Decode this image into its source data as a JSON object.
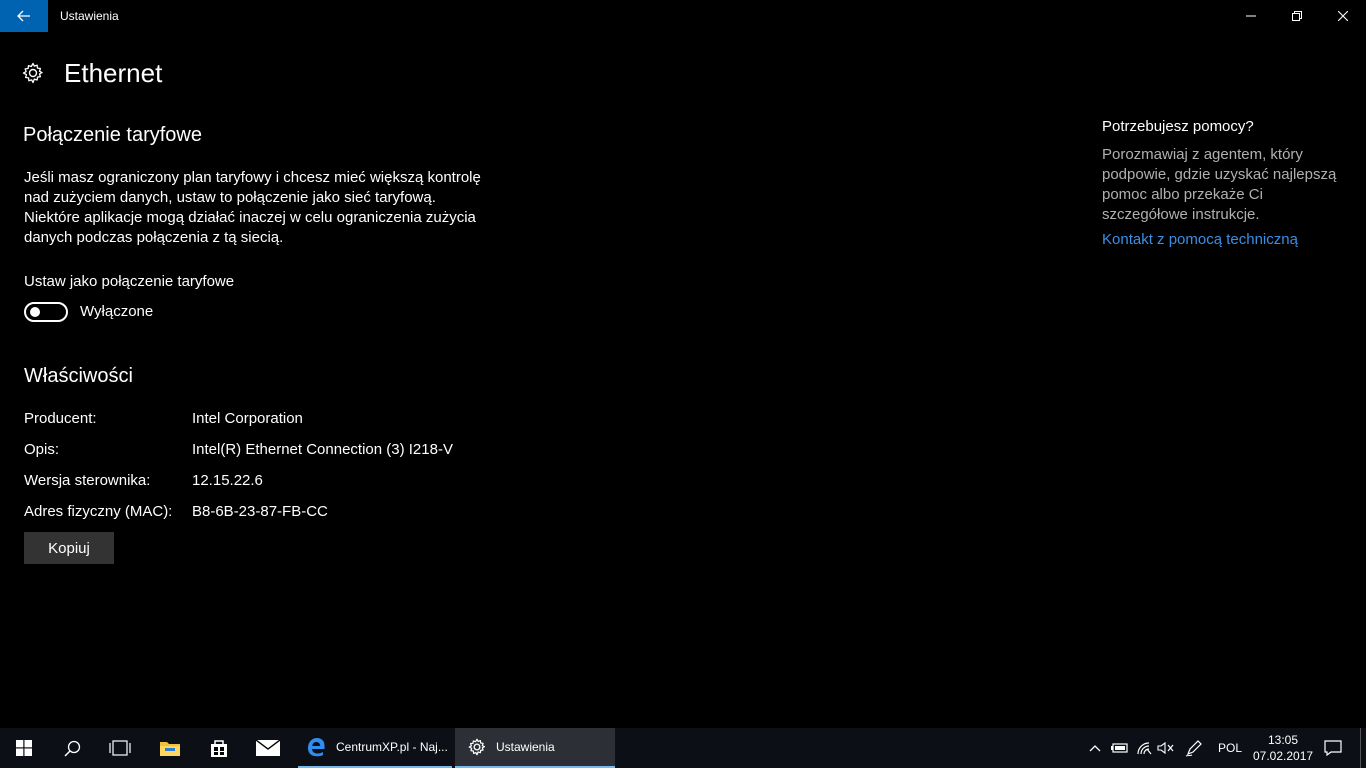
{
  "window": {
    "app_title": "Ustawienia"
  },
  "page": {
    "title": "Ethernet"
  },
  "metered": {
    "heading": "Połączenie taryfowe",
    "description": "Jeśli masz ograniczony plan taryfowy i chcesz mieć większą kontrolę nad zużyciem danych, ustaw to połączenie jako sieć taryfową. Niektóre aplikacje mogą działać inaczej w celu ograniczenia zużycia danych podczas połączenia z tą siecią.",
    "toggle_label": "Ustaw jako połączenie taryfowe",
    "toggle_state": "Wyłączone",
    "toggle_on": false
  },
  "properties": {
    "heading": "Właściwości",
    "rows": [
      {
        "key": "Producent:",
        "value": "Intel Corporation"
      },
      {
        "key": "Opis:",
        "value": "Intel(R) Ethernet Connection (3) I218-V"
      },
      {
        "key": "Wersja sterownika:",
        "value": "12.15.22.6"
      },
      {
        "key": "Adres fizyczny (MAC):",
        "value": "B8-6B-23-87-FB-CC"
      }
    ],
    "copy_label": "Kopiuj"
  },
  "help": {
    "title": "Potrzebujesz pomocy?",
    "text": "Porozmawiaj z agentem, który podpowie, gdzie uzyskać najlepszą pomoc albo przekaże Ci szczegółowe instrukcje.",
    "link": "Kontakt z pomocą techniczną"
  },
  "taskbar": {
    "apps": [
      {
        "label": "CentrumXP.pl - Naj..."
      },
      {
        "label": "Ustawienia"
      }
    ],
    "language": "POL",
    "time": "13:05",
    "date": "07.02.2017"
  },
  "colors": {
    "accent": "#0063b1",
    "link": "#3a8ee6",
    "taskbar": "#0c0f16"
  }
}
